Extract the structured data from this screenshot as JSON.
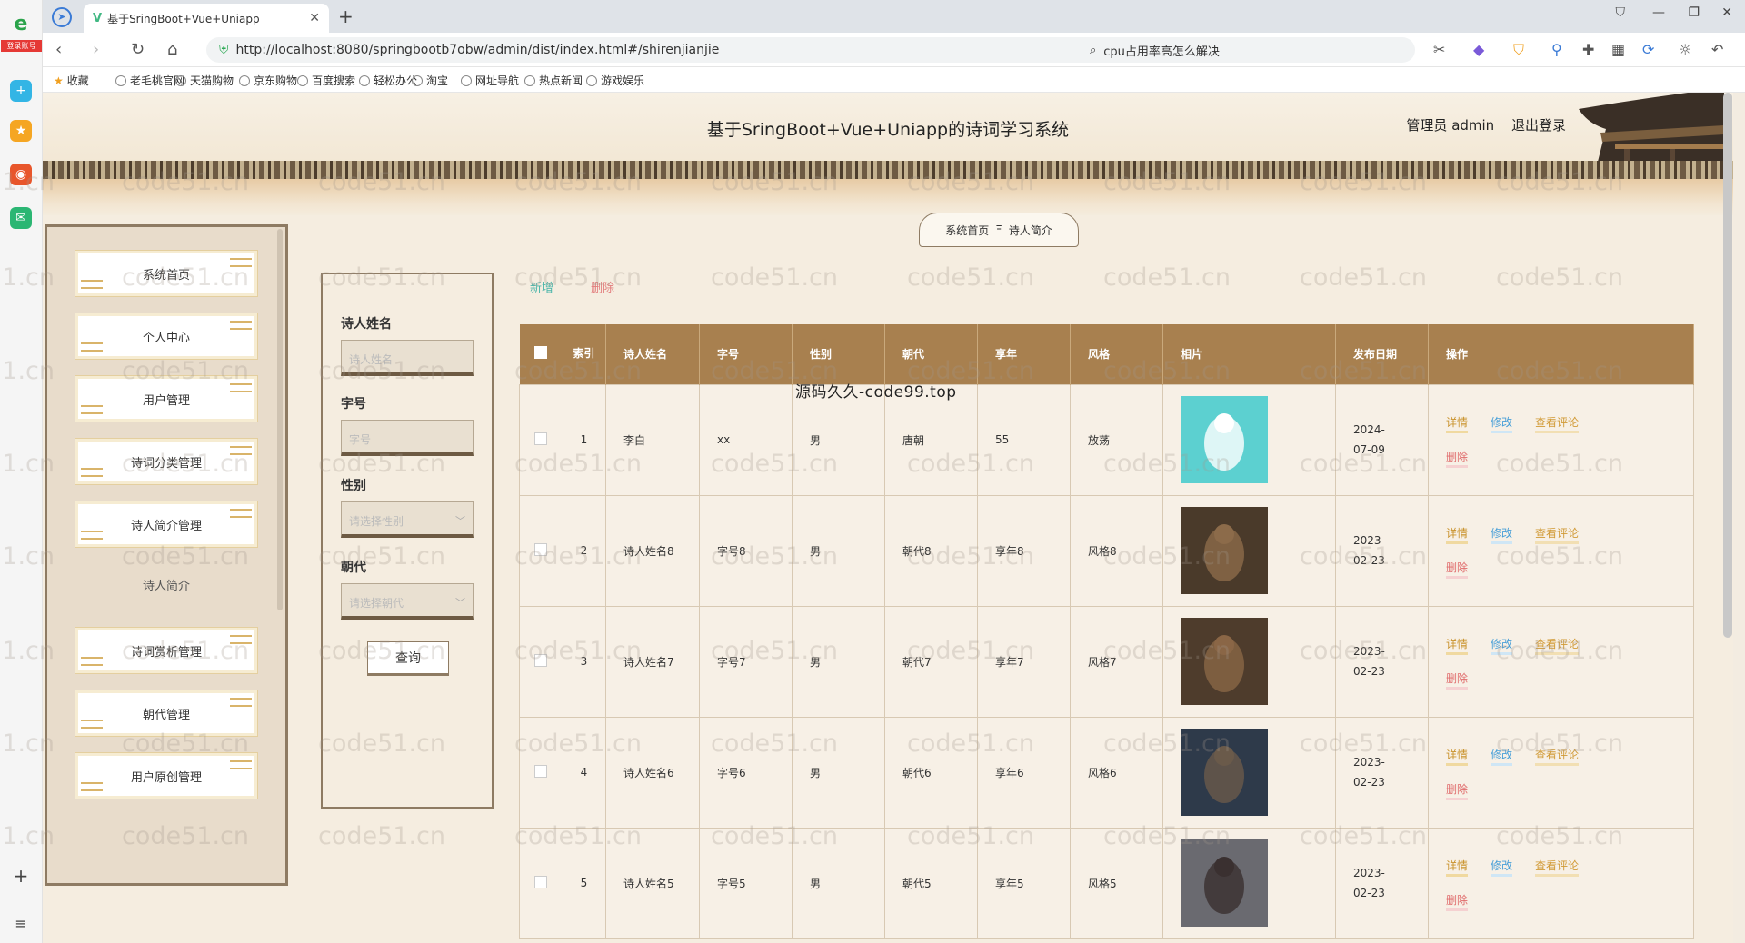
{
  "browser": {
    "tab_title": "基于SringBoot+Vue+Uniapp",
    "tab_icon": "V",
    "url": "http://localhost:8080/springbootb7obw/admin/dist/index.html#/shirenjianjie",
    "search_text": "cpu占用率高怎么解决",
    "login_badge": "登录账号",
    "bookmarks": [
      "收藏",
      "老毛桃官网",
      "天猫购物",
      "京东购物",
      "百度搜索",
      "轻松办公",
      "淘宝",
      "网址导航",
      "热点新闻",
      "游戏娱乐"
    ]
  },
  "header": {
    "title": "基于SringBoot+Vue+Uniapp的诗词学习系统",
    "user": "管理员 admin",
    "logout": "退出登录"
  },
  "breadcrumb": {
    "home": "系统首页",
    "separator": "Ξ",
    "current": "诗人简介"
  },
  "sidebar": {
    "items": [
      {
        "label": "系统首页"
      },
      {
        "label": "个人中心"
      },
      {
        "label": "用户管理"
      },
      {
        "label": "诗词分类管理"
      },
      {
        "label": "诗人简介管理"
      },
      {
        "label": "诗词赏析管理"
      },
      {
        "label": "朝代管理"
      },
      {
        "label": "用户原创管理"
      }
    ],
    "sub_item": "诗人简介"
  },
  "search": {
    "name_label": "诗人姓名",
    "name_placeholder": "诗人姓名",
    "zihao_label": "字号",
    "zihao_placeholder": "字号",
    "gender_label": "性别",
    "gender_placeholder": "请选择性别",
    "dynasty_label": "朝代",
    "dynasty_placeholder": "请选择朝代",
    "query_button": "查询"
  },
  "actions": {
    "add": "新增",
    "delete": "删除"
  },
  "table": {
    "headers": [
      "索引",
      "诗人姓名",
      "字号",
      "性别",
      "朝代",
      "享年",
      "风格",
      "相片",
      "发布日期",
      "操作"
    ],
    "index_header": "索\n引",
    "rows": [
      {
        "index": "1",
        "name": "李白",
        "zihao": "xx",
        "gender": "男",
        "dynasty": "唐朝",
        "age": "55",
        "style": "放荡",
        "date": "2024-07-09"
      },
      {
        "index": "2",
        "name": "诗人姓名8",
        "zihao": "字号8",
        "gender": "男",
        "dynasty": "朝代8",
        "age": "享年8",
        "style": "风格8",
        "date": "2023-02-23"
      },
      {
        "index": "3",
        "name": "诗人姓名7",
        "zihao": "字号7",
        "gender": "男",
        "dynasty": "朝代7",
        "age": "享年7",
        "style": "风格7",
        "date": "2023-02-23"
      },
      {
        "index": "4",
        "name": "诗人姓名6",
        "zihao": "字号6",
        "gender": "男",
        "dynasty": "朝代6",
        "age": "享年6",
        "style": "风格6",
        "date": "2023-02-23"
      },
      {
        "index": "5",
        "name": "诗人姓名5",
        "zihao": "字号5",
        "gender": "男",
        "dynasty": "朝代5",
        "age": "享年5",
        "style": "风格5",
        "date": "2023-02-23"
      }
    ],
    "ops": {
      "detail": "详情",
      "edit": "修改",
      "comments": "查看评论",
      "delete": "删除"
    }
  },
  "overlay_text": "源码久久-code99.top",
  "watermark": "code51.cn",
  "colors": {
    "header_bg": "#a8804f",
    "border": "#8e7b63",
    "add": "#4ab5a9",
    "delete": "#e27d7d"
  }
}
